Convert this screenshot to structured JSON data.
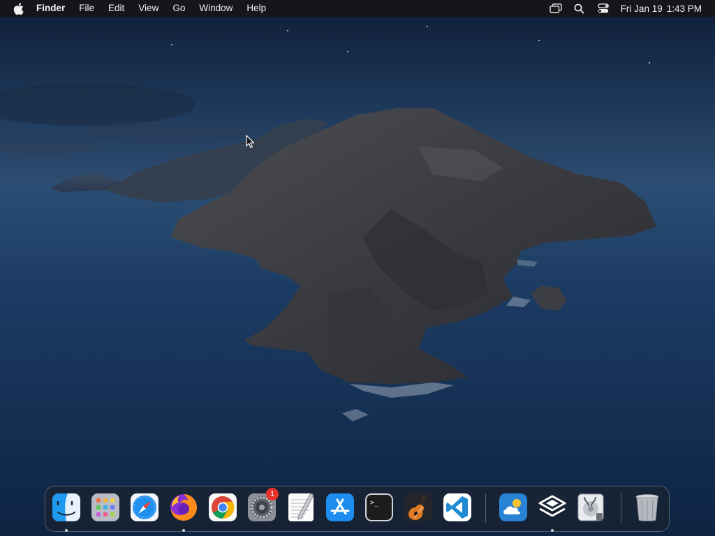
{
  "menubar": {
    "apple_icon": "apple-logo-icon",
    "app_name": "Finder",
    "menus": [
      "File",
      "Edit",
      "View",
      "Go",
      "Window",
      "Help"
    ],
    "status_icons": [
      "screen-mirroring-icon",
      "search-icon",
      "control-center-icon"
    ],
    "clock": {
      "date": "Fri Jan 19",
      "time": "1:43 PM"
    }
  },
  "dock": {
    "apps": [
      {
        "name": "Finder",
        "icon": "finder-icon",
        "running": true
      },
      {
        "name": "Launchpad",
        "icon": "launchpad-icon",
        "running": false
      },
      {
        "name": "Safari",
        "icon": "safari-icon",
        "running": false
      },
      {
        "name": "Firefox",
        "icon": "firefox-icon",
        "running": true
      },
      {
        "name": "Google Chrome",
        "icon": "chrome-icon",
        "running": false
      },
      {
        "name": "System Preferences",
        "icon": "system-preferences-icon",
        "running": false,
        "badge": "1"
      },
      {
        "name": "TextEdit",
        "icon": "textedit-icon",
        "running": false
      },
      {
        "name": "App Store",
        "icon": "app-store-icon",
        "running": false
      },
      {
        "name": "Terminal",
        "icon": "terminal-icon",
        "running": false
      },
      {
        "name": "GarageBand",
        "icon": "garageband-icon",
        "running": false
      },
      {
        "name": "Visual Studio Code",
        "icon": "vscode-icon",
        "running": false
      },
      {
        "name": "Weather",
        "icon": "weather-icon",
        "running": false
      },
      {
        "name": "Layers",
        "icon": "layers-icon",
        "running": true
      },
      {
        "name": "Disk Utility",
        "icon": "disk-utility-icon",
        "running": false
      },
      {
        "name": "Trash",
        "icon": "trash-icon",
        "running": false
      }
    ],
    "terminal_prompt": ">_"
  },
  "colors": {
    "menubar_bg": "#161618",
    "sky_top": "#13233f",
    "sea": "#16345a",
    "badge": "#e8332b"
  }
}
